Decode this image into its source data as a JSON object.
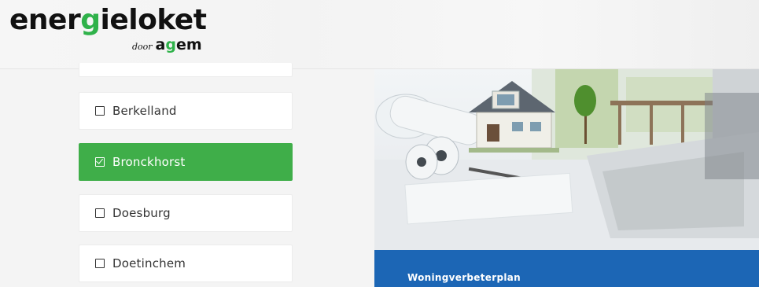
{
  "brand": {
    "logo_prefix": "ener",
    "logo_g": "g",
    "logo_suffix": "ieloket",
    "logo_door": "door",
    "logo_agem_a": "a",
    "logo_agem_g": "g",
    "logo_agem_rest": "em",
    "accent_green": "#3fae49",
    "accent_blue": "#1c66b5"
  },
  "municipalities": [
    {
      "label": "",
      "checked": false
    },
    {
      "label": "Berkelland",
      "checked": false
    },
    {
      "label": "Bronckhorst",
      "checked": true
    },
    {
      "label": "Doesburg",
      "checked": false
    },
    {
      "label": "Doetinchem",
      "checked": false
    }
  ],
  "card": {
    "title": "Woningverbeterplan",
    "image": "house-model-with-blueprints-and-laptop"
  }
}
